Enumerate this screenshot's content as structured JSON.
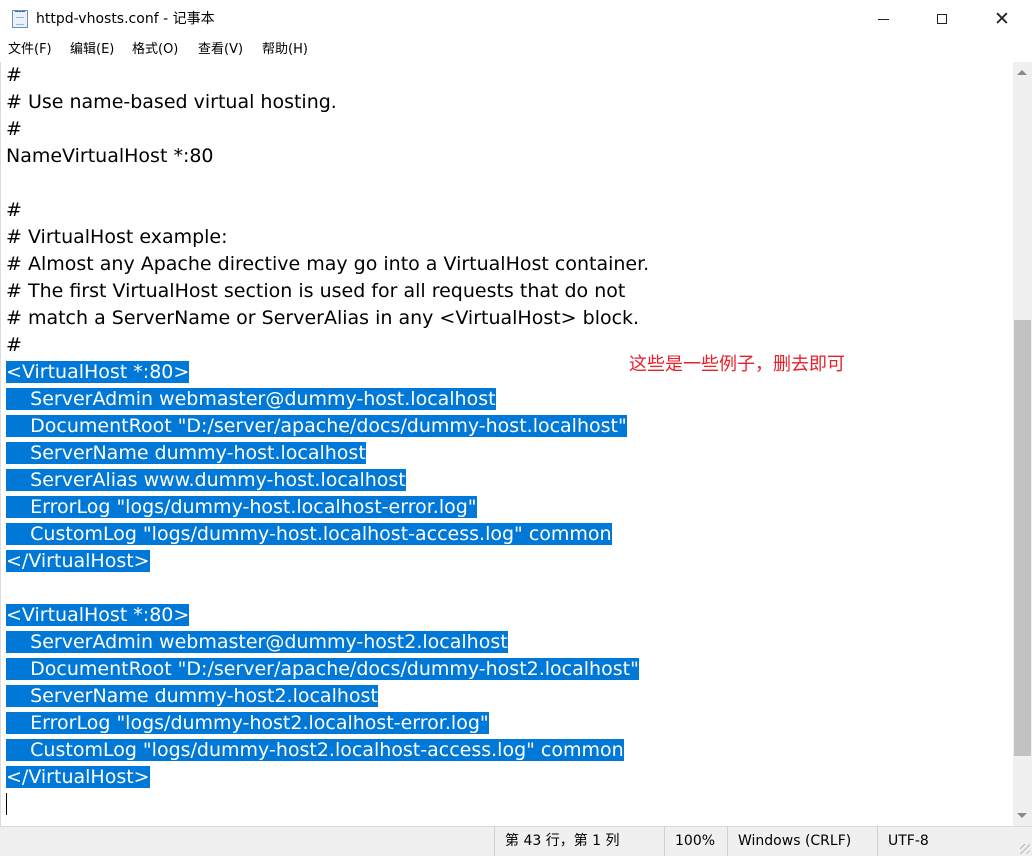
{
  "window": {
    "title": "httpd-vhosts.conf - 记事本",
    "minimize_glyph": "minimize",
    "maximize_glyph": "maximize",
    "close_glyph": "✕"
  },
  "menu": [
    "文件(F)",
    "编辑(E)",
    "格式(O)",
    "查看(V)",
    "帮助(H)"
  ],
  "editor": {
    "lines": [
      {
        "text": "#",
        "selected": false
      },
      {
        "text": "# Use name-based virtual hosting.",
        "selected": false
      },
      {
        "text": "#",
        "selected": false
      },
      {
        "text": "NameVirtualHost *:80",
        "selected": false
      },
      {
        "text": "",
        "selected": false
      },
      {
        "text": "#",
        "selected": false
      },
      {
        "text": "# VirtualHost example:",
        "selected": false
      },
      {
        "text": "# Almost any Apache directive may go into a VirtualHost container.",
        "selected": false
      },
      {
        "text": "# The first VirtualHost section is used for all requests that do not",
        "selected": false
      },
      {
        "text": "# match a ServerName or ServerAlias in any <VirtualHost> block.",
        "selected": false
      },
      {
        "text": "#",
        "selected": false
      },
      {
        "text": "<VirtualHost *:80>",
        "selected": true
      },
      {
        "text": "    ServerAdmin webmaster@dummy-host.localhost",
        "selected": true
      },
      {
        "text": "    DocumentRoot \"D:/server/apache/docs/dummy-host.localhost\"",
        "selected": true
      },
      {
        "text": "    ServerName dummy-host.localhost",
        "selected": true
      },
      {
        "text": "    ServerAlias www.dummy-host.localhost",
        "selected": true
      },
      {
        "text": "    ErrorLog \"logs/dummy-host.localhost-error.log\"",
        "selected": true
      },
      {
        "text": "    CustomLog \"logs/dummy-host.localhost-access.log\" common",
        "selected": true
      },
      {
        "text": "</VirtualHost>",
        "selected": true
      },
      {
        "text": "",
        "selected": true
      },
      {
        "text": "<VirtualHost *:80>",
        "selected": true
      },
      {
        "text": "    ServerAdmin webmaster@dummy-host2.localhost",
        "selected": true
      },
      {
        "text": "    DocumentRoot \"D:/server/apache/docs/dummy-host2.localhost\"",
        "selected": true
      },
      {
        "text": "    ServerName dummy-host2.localhost",
        "selected": true
      },
      {
        "text": "    ErrorLog \"logs/dummy-host2.localhost-error.log\"",
        "selected": true
      },
      {
        "text": "    CustomLog \"logs/dummy-host2.localhost-access.log\" common",
        "selected": true
      },
      {
        "text": "</VirtualHost>",
        "selected": true
      }
    ],
    "selection_color": "#0078d7"
  },
  "annotation": {
    "text": "这些是一些例子，删去即可",
    "color": "#e8202a"
  },
  "status": {
    "position": "第 43 行，第 1 列",
    "zoom": "100%",
    "line_ending": "Windows (CRLF)",
    "encoding": "UTF-8"
  }
}
